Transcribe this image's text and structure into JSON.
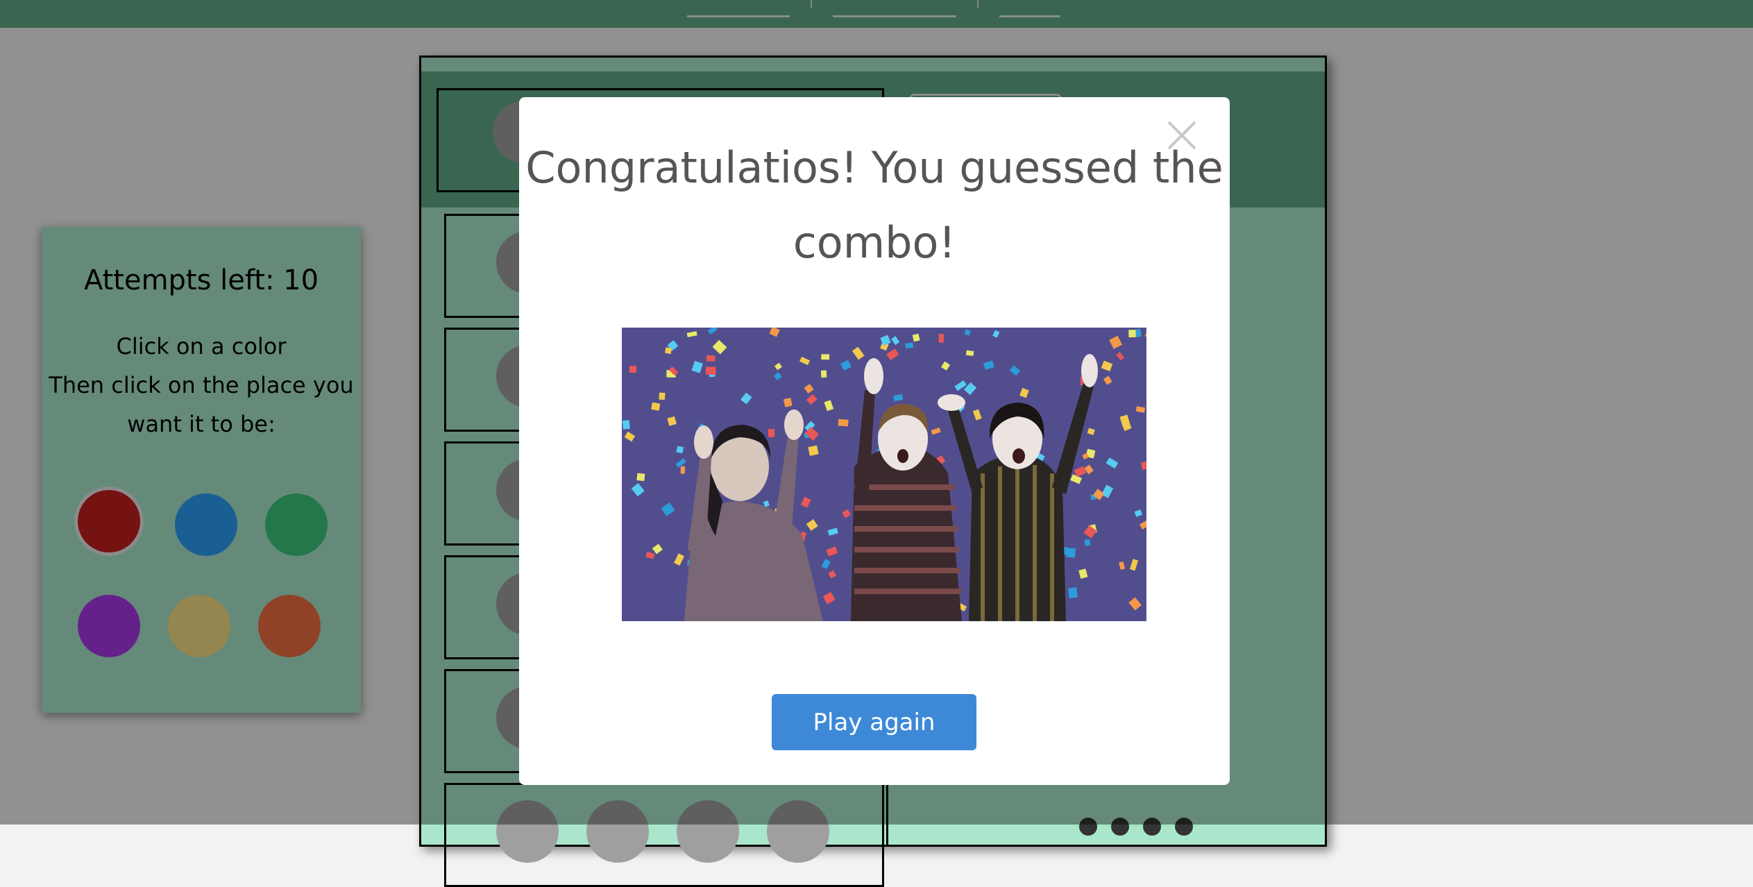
{
  "game": {
    "attempts_text": "Attempts left: 10",
    "instructions": [
      "Click on a color",
      "Then click on the place you",
      "want it to be:"
    ],
    "palette": [
      {
        "name": "red",
        "color": "#c31e1e",
        "selected": true
      },
      {
        "name": "blue",
        "color": "#2b9ef7"
      },
      {
        "name": "green",
        "color": "#3cc77c"
      },
      {
        "name": "purple",
        "color": "#a637e4"
      },
      {
        "name": "yellow",
        "color": "#f5df83"
      },
      {
        "name": "orange",
        "color": "#f06e42"
      }
    ],
    "empty_peg_color": "#9f9f9f",
    "board_color": "#a9e6cc",
    "header_color": "#5fa888"
  },
  "modal": {
    "title": "Congratulatios! You guessed the combo!",
    "image_name": "celebration-confetti-image",
    "play_again_label": "Play again",
    "primary_color": "#3d89d8"
  }
}
